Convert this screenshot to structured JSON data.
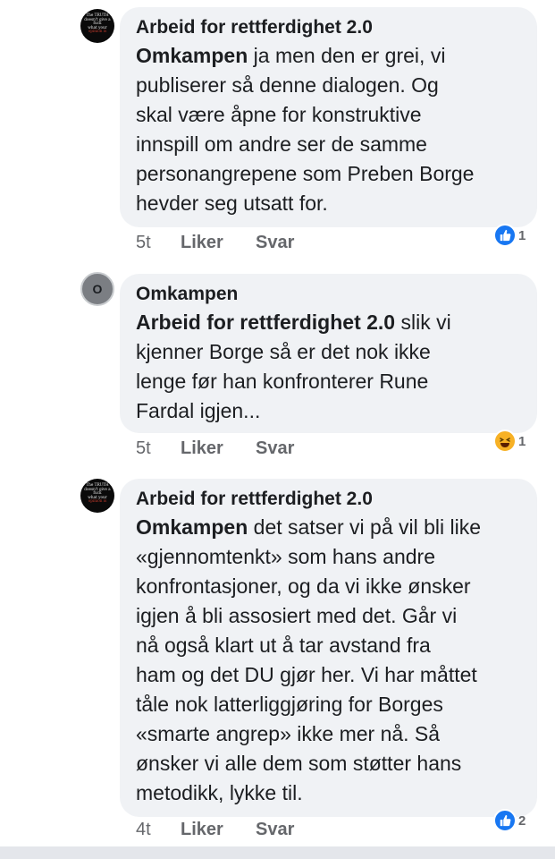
{
  "comments": [
    {
      "author": "Arbeid for rettferdighet  2.0",
      "avatar_lines": [
        "The TRUTH",
        "doesn't give a",
        "fuck",
        "what your",
        "opinion is"
      ],
      "mention": "Omkampen",
      "text_lines": [
        " ja men den er grei, vi",
        "publiserer så denne dialogen. Og",
        "skal være åpne for konstruktive",
        "innspill om andre ser de samme",
        "personangrepene som Preben Borge",
        "hevder seg utsatt for."
      ],
      "time": "5t",
      "like_label": "Liker",
      "reply_label": "Svar",
      "reaction": "like-icon",
      "reaction_count": "1"
    },
    {
      "author": "Omkampen",
      "avatar_initial": "O",
      "mention": "Arbeid for rettferdighet  2.0",
      "text_lines": [
        " slik vi",
        "kjenner Borge så er det nok ikke",
        "lenge før han konfronterer Rune",
        "Fardal igjen..."
      ],
      "time": "5t",
      "like_label": "Liker",
      "reply_label": "Svar",
      "reaction": "haha-icon",
      "reaction_count": "1"
    },
    {
      "author": "Arbeid for rettferdighet  2.0",
      "avatar_lines": [
        "The TRUTH",
        "doesn't give a",
        "fuck",
        "what your",
        "opinion is"
      ],
      "mention": "Omkampen",
      "text_lines": [
        " det satser vi på vil bli like",
        "«gjennomtenkt» som hans andre",
        "konfrontasjoner, og da vi ikke ønsker",
        "igjen å bli assosiert med det. Går vi",
        "nå også klart ut å tar avstand fra",
        "ham og det DU gjør her. Vi har måttet",
        "tåle nok latterliggjøring for Borges",
        "«smarte angrep» ikke mer nå. Så",
        "ønsker vi alle dem som støtter hans",
        "metodikk, lykke til."
      ],
      "time": "4t",
      "like_label": "Liker",
      "reply_label": "Svar",
      "reaction": "like-icon",
      "reaction_count": "2"
    }
  ],
  "colors": {
    "bubble": "#f0f2f5",
    "like_blue": "#1877f2",
    "haha_yellow": "#f7b125",
    "meta_grey": "#65676b"
  }
}
